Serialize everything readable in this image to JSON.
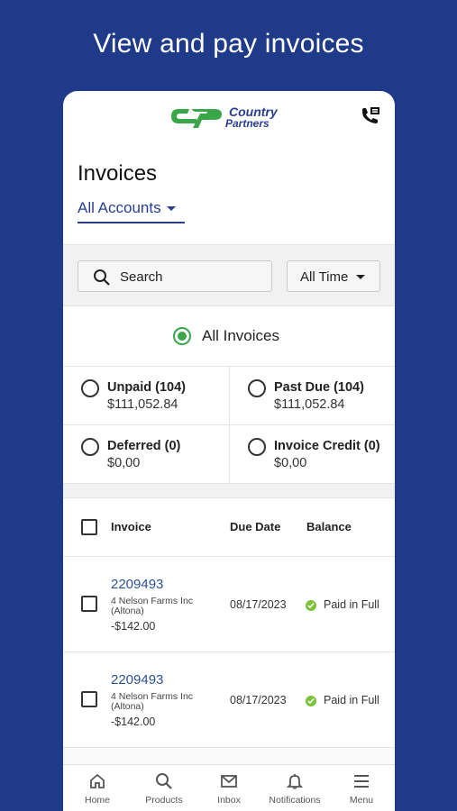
{
  "promo": {
    "headline": "View and pay invoices"
  },
  "brand": {
    "name_line1": "Country",
    "name_line2": "Partners"
  },
  "header": {
    "title": "Invoices",
    "account_selector": "All Accounts"
  },
  "filters": {
    "search_placeholder": "Search",
    "time_filter": "All Time"
  },
  "invoice_types": {
    "all": {
      "label": "All Invoices",
      "selected": true
    },
    "options": [
      {
        "label": "Unpaid (104)",
        "amount": "$111,052.84"
      },
      {
        "label": "Past Due (104)",
        "amount": "$111,052.84"
      },
      {
        "label": "Deferred (0)",
        "amount": "$0,00"
      },
      {
        "label": "Invoice Credit (0)",
        "amount": "$0,00"
      }
    ]
  },
  "table": {
    "columns": [
      "Invoice",
      "Due Date",
      "Balance"
    ],
    "rows": [
      {
        "invoice": "2209493",
        "customer": "4 Nelson Farms Inc (Altona)",
        "amount": "-$142.00",
        "due_date": "08/17/2023",
        "status": "Paid in Full"
      },
      {
        "invoice": "2209493",
        "customer": "4 Nelson Farms Inc (Altona)",
        "amount": "-$142.00",
        "due_date": "08/17/2023",
        "status": "Paid in Full"
      }
    ]
  },
  "nav": {
    "items": [
      {
        "label": "Home",
        "icon": "home-icon"
      },
      {
        "label": "Products",
        "icon": "search-icon"
      },
      {
        "label": "Inbox",
        "icon": "mail-icon"
      },
      {
        "label": "Notifications",
        "icon": "bell-icon"
      },
      {
        "label": "Menu",
        "icon": "menu-icon"
      }
    ]
  },
  "colors": {
    "background": "#203a8a",
    "accent": "#2a3d8f",
    "brand_green": "#3aa64a",
    "paid_status": "#7cc23a"
  }
}
